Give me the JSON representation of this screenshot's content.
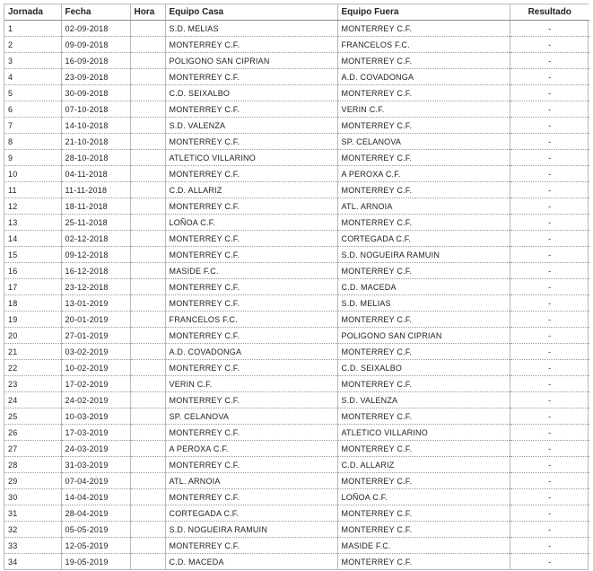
{
  "table": {
    "headers": {
      "jornada": "Jornada",
      "fecha": "Fecha",
      "hora": "Hora",
      "casa": "Equipo Casa",
      "fuera": "Equipo Fuera",
      "resultado": "Resultado"
    },
    "rows": [
      {
        "jornada": "1",
        "fecha": "02-09-2018",
        "hora": "",
        "casa": "S.D. MELIAS",
        "fuera": "MONTERREY C.F.",
        "resultado": "-"
      },
      {
        "jornada": "2",
        "fecha": "09-09-2018",
        "hora": "",
        "casa": "MONTERREY C.F.",
        "fuera": "FRANCELOS F.C.",
        "resultado": "-"
      },
      {
        "jornada": "3",
        "fecha": "16-09-2018",
        "hora": "",
        "casa": "POLIGONO SAN CIPRIAN",
        "fuera": "MONTERREY C.F.",
        "resultado": "-"
      },
      {
        "jornada": "4",
        "fecha": "23-09-2018",
        "hora": "",
        "casa": "MONTERREY C.F.",
        "fuera": "A.D. COVADONGA",
        "resultado": "-"
      },
      {
        "jornada": "5",
        "fecha": "30-09-2018",
        "hora": "",
        "casa": "C.D. SEIXALBO",
        "fuera": "MONTERREY C.F.",
        "resultado": "-"
      },
      {
        "jornada": "6",
        "fecha": "07-10-2018",
        "hora": "",
        "casa": "MONTERREY C.F.",
        "fuera": "VERIN C.F.",
        "resultado": "-"
      },
      {
        "jornada": "7",
        "fecha": "14-10-2018",
        "hora": "",
        "casa": "S.D. VALENZA",
        "fuera": "MONTERREY C.F.",
        "resultado": "-"
      },
      {
        "jornada": "8",
        "fecha": "21-10-2018",
        "hora": "",
        "casa": "MONTERREY C.F.",
        "fuera": "SP. CELANOVA",
        "resultado": "-"
      },
      {
        "jornada": "9",
        "fecha": "28-10-2018",
        "hora": "",
        "casa": "ATLETICO VILLARINO",
        "fuera": "MONTERREY C.F.",
        "resultado": "-"
      },
      {
        "jornada": "10",
        "fecha": "04-11-2018",
        "hora": "",
        "casa": "MONTERREY C.F.",
        "fuera": "A PEROXA C.F.",
        "resultado": "-"
      },
      {
        "jornada": "11",
        "fecha": "11-11-2018",
        "hora": "",
        "casa": "C.D. ALLARIZ",
        "fuera": "MONTERREY C.F.",
        "resultado": "-"
      },
      {
        "jornada": "12",
        "fecha": "18-11-2018",
        "hora": "",
        "casa": "MONTERREY C.F.",
        "fuera": "ATL. ARNOIA",
        "resultado": "-"
      },
      {
        "jornada": "13",
        "fecha": "25-11-2018",
        "hora": "",
        "casa": "LOÑOA C.F.",
        "fuera": "MONTERREY C.F.",
        "resultado": "-"
      },
      {
        "jornada": "14",
        "fecha": "02-12-2018",
        "hora": "",
        "casa": "MONTERREY C.F.",
        "fuera": "CORTEGADA C.F.",
        "resultado": "-"
      },
      {
        "jornada": "15",
        "fecha": "09-12-2018",
        "hora": "",
        "casa": "MONTERREY C.F.",
        "fuera": "S.D. NOGUEIRA RAMUIN",
        "resultado": "-"
      },
      {
        "jornada": "16",
        "fecha": "16-12-2018",
        "hora": "",
        "casa": "MASIDE F.C.",
        "fuera": "MONTERREY C.F.",
        "resultado": "-"
      },
      {
        "jornada": "17",
        "fecha": "23-12-2018",
        "hora": "",
        "casa": "MONTERREY C.F.",
        "fuera": "C.D. MACEDA",
        "resultado": "-"
      },
      {
        "jornada": "18",
        "fecha": "13-01-2019",
        "hora": "",
        "casa": "MONTERREY C.F.",
        "fuera": "S.D. MELIAS",
        "resultado": "-"
      },
      {
        "jornada": "19",
        "fecha": "20-01-2019",
        "hora": "",
        "casa": "FRANCELOS F.C.",
        "fuera": "MONTERREY C.F.",
        "resultado": "-"
      },
      {
        "jornada": "20",
        "fecha": "27-01-2019",
        "hora": "",
        "casa": "MONTERREY C.F.",
        "fuera": "POLIGONO SAN CIPRIAN",
        "resultado": "-"
      },
      {
        "jornada": "21",
        "fecha": "03-02-2019",
        "hora": "",
        "casa": "A.D. COVADONGA",
        "fuera": "MONTERREY C.F.",
        "resultado": "-"
      },
      {
        "jornada": "22",
        "fecha": "10-02-2019",
        "hora": "",
        "casa": "MONTERREY C.F.",
        "fuera": "C.D. SEIXALBO",
        "resultado": "-"
      },
      {
        "jornada": "23",
        "fecha": "17-02-2019",
        "hora": "",
        "casa": "VERIN C.F.",
        "fuera": "MONTERREY C.F.",
        "resultado": "-"
      },
      {
        "jornada": "24",
        "fecha": "24-02-2019",
        "hora": "",
        "casa": "MONTERREY C.F.",
        "fuera": "S.D. VALENZA",
        "resultado": "-"
      },
      {
        "jornada": "25",
        "fecha": "10-03-2019",
        "hora": "",
        "casa": "SP. CELANOVA",
        "fuera": "MONTERREY C.F.",
        "resultado": "-"
      },
      {
        "jornada": "26",
        "fecha": "17-03-2019",
        "hora": "",
        "casa": "MONTERREY C.F.",
        "fuera": "ATLETICO VILLARINO",
        "resultado": "-"
      },
      {
        "jornada": "27",
        "fecha": "24-03-2019",
        "hora": "",
        "casa": "A PEROXA C.F.",
        "fuera": "MONTERREY C.F.",
        "resultado": "-"
      },
      {
        "jornada": "28",
        "fecha": "31-03-2019",
        "hora": "",
        "casa": "MONTERREY C.F.",
        "fuera": "C.D. ALLARIZ",
        "resultado": "-"
      },
      {
        "jornada": "29",
        "fecha": "07-04-2019",
        "hora": "",
        "casa": "ATL. ARNOIA",
        "fuera": "MONTERREY C.F.",
        "resultado": "-"
      },
      {
        "jornada": "30",
        "fecha": "14-04-2019",
        "hora": "",
        "casa": "MONTERREY C.F.",
        "fuera": "LOÑOA C.F.",
        "resultado": "-"
      },
      {
        "jornada": "31",
        "fecha": "28-04-2019",
        "hora": "",
        "casa": "CORTEGADA C.F.",
        "fuera": "MONTERREY C.F.",
        "resultado": "-"
      },
      {
        "jornada": "32",
        "fecha": "05-05-2019",
        "hora": "",
        "casa": "S.D. NOGUEIRA RAMUIN",
        "fuera": "MONTERREY C.F.",
        "resultado": "-"
      },
      {
        "jornada": "33",
        "fecha": "12-05-2019",
        "hora": "",
        "casa": "MONTERREY C.F.",
        "fuera": "MASIDE F.C.",
        "resultado": "-"
      },
      {
        "jornada": "34",
        "fecha": "19-05-2019",
        "hora": "",
        "casa": "C.D. MACEDA",
        "fuera": "MONTERREY C.F.",
        "resultado": "-"
      }
    ]
  }
}
